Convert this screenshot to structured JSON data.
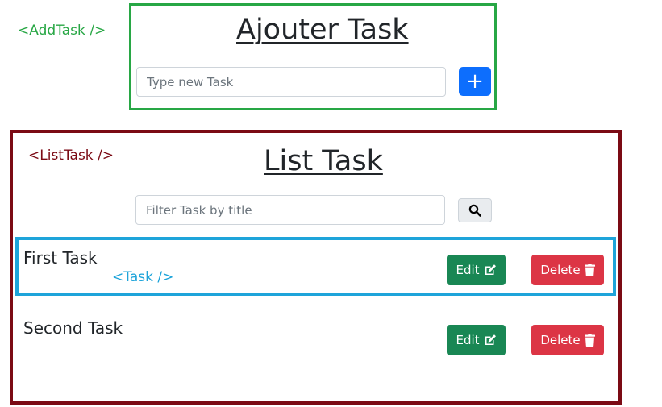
{
  "annotations": {
    "add_task": "<AddTask />",
    "list_task": "<ListTask />",
    "task": "<Task />"
  },
  "add_task": {
    "title": "Ajouter Task",
    "input_placeholder": "Type new Task",
    "add_button_label": "+"
  },
  "list_task": {
    "title": "List Task",
    "filter_placeholder": "Filter Task by title",
    "search_icon": "search-icon"
  },
  "tasks": [
    {
      "title": "First Task",
      "edit_label": "Edit",
      "delete_label": "Delete"
    },
    {
      "title": "Second Task",
      "edit_label": "Edit",
      "delete_label": "Delete"
    }
  ],
  "colors": {
    "add_task_border": "#28a745",
    "list_task_border": "#7b0a14",
    "task_border": "#1ea4da",
    "primary": "#0d6efd",
    "success": "#198754",
    "danger": "#dc3545"
  }
}
